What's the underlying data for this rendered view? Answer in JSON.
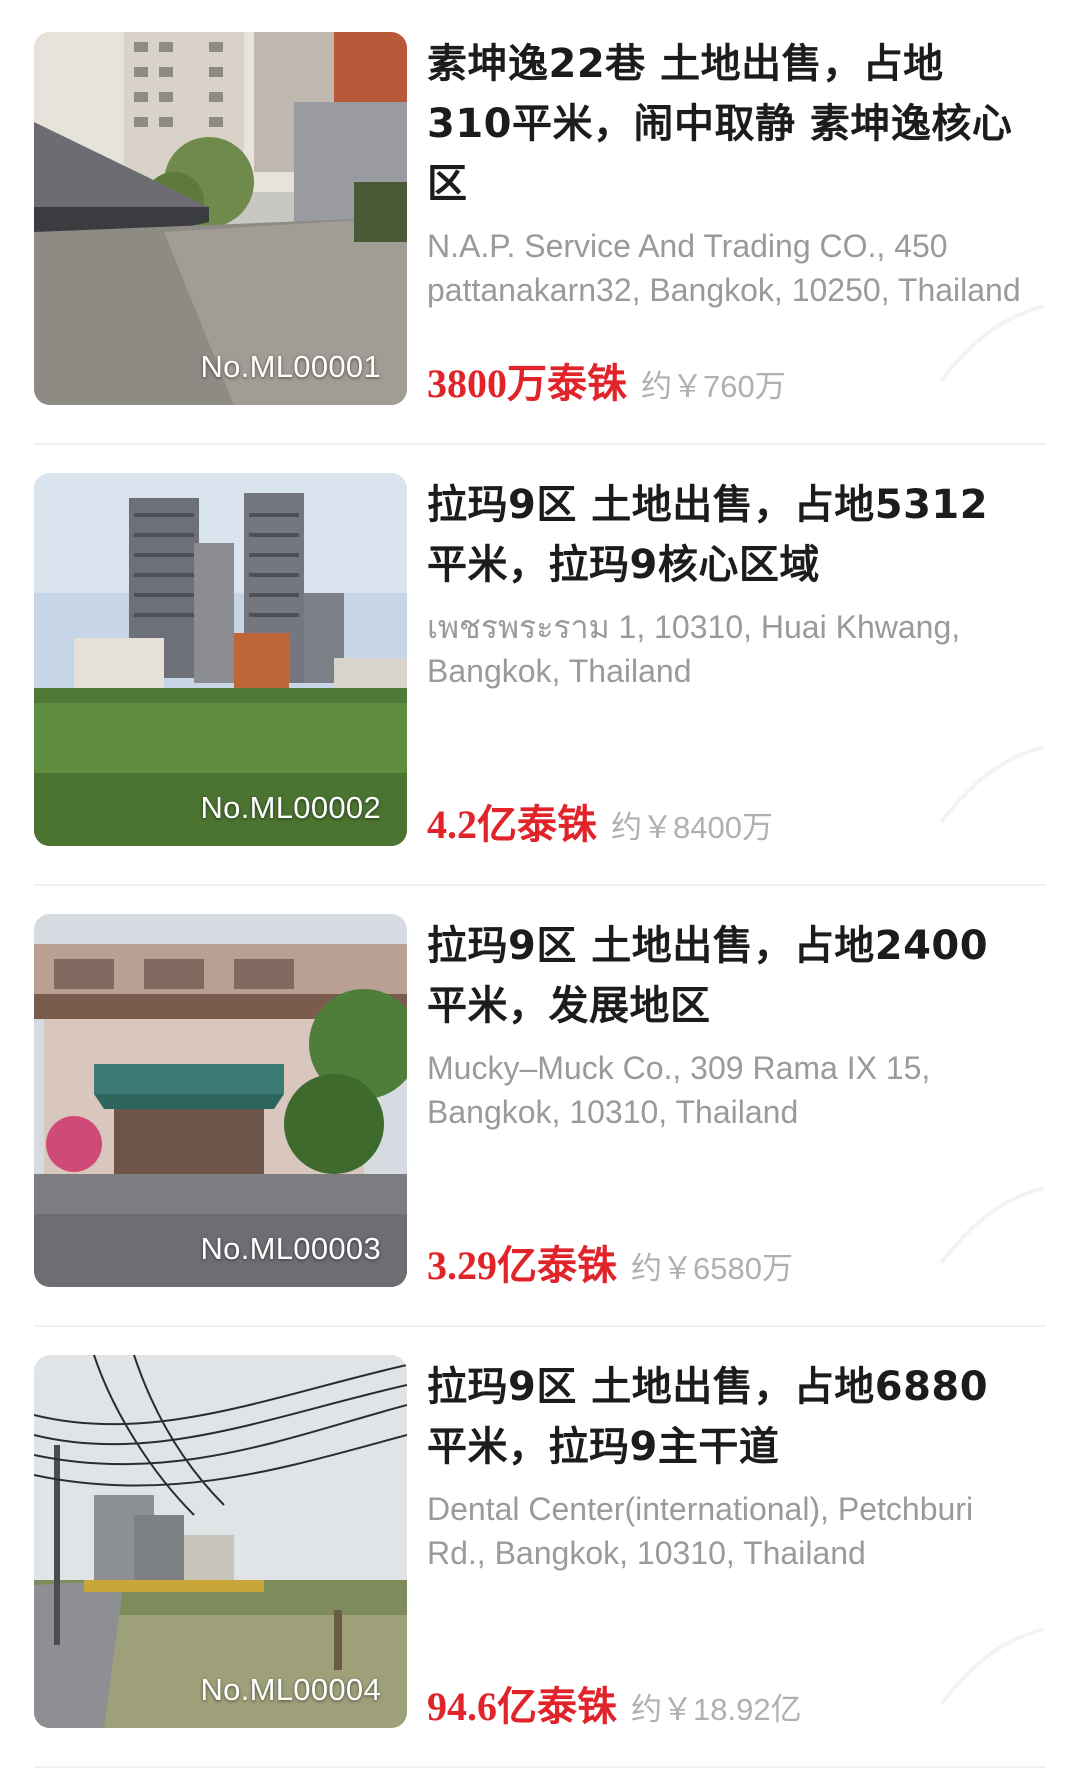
{
  "listings": [
    {
      "code": "No.ML00001",
      "title": "素坤逸22巷 土地出售，占地310平米，闹中取静 素坤逸核心区",
      "address": "N.A.P. Service And Trading CO., 450 pattanakarn32, Bangkok, 10250, Thailand",
      "price": "3800万泰铢",
      "approx": "约￥760万"
    },
    {
      "code": "No.ML00002",
      "title": "拉玛9区 土地出售，占地5312平米，拉玛9核心区域",
      "address": "เพชรพระราม 1, 10310, Huai Khwang, Bangkok, Thailand",
      "price": "4.2亿泰铢",
      "approx": "约￥8400万"
    },
    {
      "code": "No.ML00003",
      "title": "拉玛9区 土地出售，占地2400平米，发展地区",
      "address": "Mucky–Muck Co., 309 Rama IX 15, Bangkok, 10310, Thailand",
      "price": "3.29亿泰铢",
      "approx": "约￥6580万"
    },
    {
      "code": "No.ML00004",
      "title": "拉玛9区 土地出售，占地6880平米，拉玛9主干道",
      "address": "Dental Center(international), Petchburi Rd., Bangkok, 10310, Thailand",
      "price": "94.6亿泰铢",
      "approx": "约￥18.92亿"
    }
  ],
  "colors": {
    "price": "#e0242a",
    "title": "#1c1c1c",
    "address": "#9a9a9a",
    "approx": "#b0b0b0"
  },
  "icons": {
    "thumbnail_1": "parking-lot-photo",
    "thumbnail_2": "high-rise-towers-over-field-photo",
    "thumbnail_3": "two-story-house-photo",
    "thumbnail_4": "power-lines-over-empty-lot-photo"
  }
}
